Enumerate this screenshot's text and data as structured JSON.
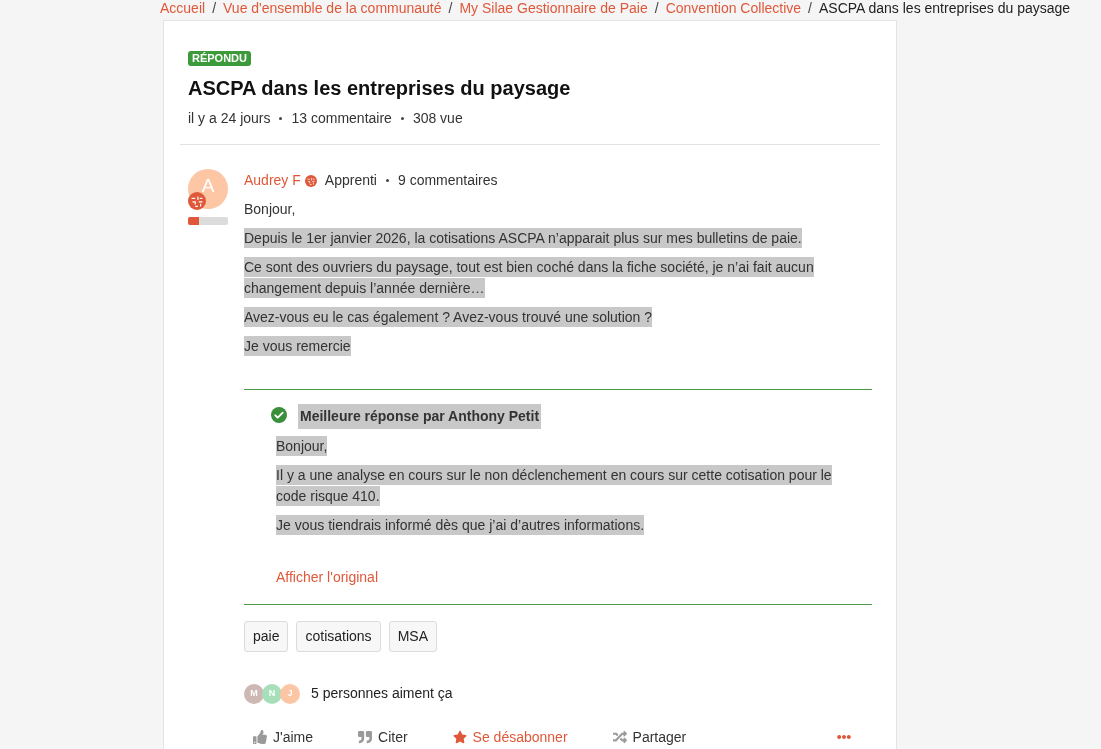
{
  "breadcrumb": {
    "items": [
      {
        "label": "Accueil",
        "current": false
      },
      {
        "label": "Vue d'ensemble de la communauté",
        "current": false
      },
      {
        "label": "My Silae Gestionnaire de Paie",
        "current": false
      },
      {
        "label": "Convention Collective",
        "current": false
      },
      {
        "label": "ASCPA dans les entreprises du paysage",
        "current": true
      }
    ],
    "separators": [
      "/",
      "/",
      "/",
      "/"
    ]
  },
  "topic": {
    "status_badge": "RÉPONDU",
    "title": "ASCPA dans les entreprises du paysage",
    "meta": [
      "il y a 24 jours",
      "13 commentaire",
      "308 vue"
    ]
  },
  "post": {
    "author": {
      "avatar_letter": "A",
      "name": "Audrey F",
      "rank": "Apprenti",
      "comments": "9 commentaires",
      "level": 0.28
    },
    "paragraphs": [
      {
        "text": "Bonjour,",
        "highlighted": false
      },
      {
        "text": "Depuis le 1er janvier 2026, la cotisations ASCPA n’apparait plus sur mes bulletins de paie.",
        "highlighted": true
      },
      {
        "text": "Ce sont des ouvriers du paysage, tout est bien coché dans la fiche société, je n’ai fait aucun changement depuis l’année dernière…",
        "highlighted": true
      },
      {
        "text": "Avez-vous eu le cas également ? Avez-vous trouvé une solution ?",
        "highlighted": true
      },
      {
        "text": "Je vous remercie",
        "highlighted": true
      }
    ]
  },
  "best_answer": {
    "title": "Meilleure réponse par Anthony Petit",
    "title_highlighted": true,
    "paragraphs": [
      {
        "text": "Bonjour,",
        "highlighted": true
      },
      {
        "text": "Il y a une analyse en cours sur le non déclenchement en cours sur cette cotisation pour le code risque 410.",
        "highlighted": true
      },
      {
        "text": "Je vous tiendrais informé dès que j’ai d’autres informations.",
        "highlighted": true
      }
    ],
    "show_original_link": "Afficher l'original"
  },
  "tags": [
    "paie",
    "cotisations",
    "MSA"
  ],
  "likes": {
    "avatars": [
      {
        "letter": "M",
        "color": "#cdb8b3"
      },
      {
        "letter": "N",
        "color": "#a8dfbb"
      },
      {
        "letter": "J",
        "color": "#fcc6a4"
      }
    ],
    "text": "5 personnes aiment ça"
  },
  "actions": [
    {
      "kind": "like",
      "label": "J'aime",
      "active": false
    },
    {
      "kind": "quote",
      "label": "Citer",
      "active": false
    },
    {
      "kind": "subscribe",
      "label": "Se désabonner",
      "active": true
    },
    {
      "kind": "share",
      "label": "Partager",
      "active": false
    },
    {
      "kind": "more"
    }
  ]
}
